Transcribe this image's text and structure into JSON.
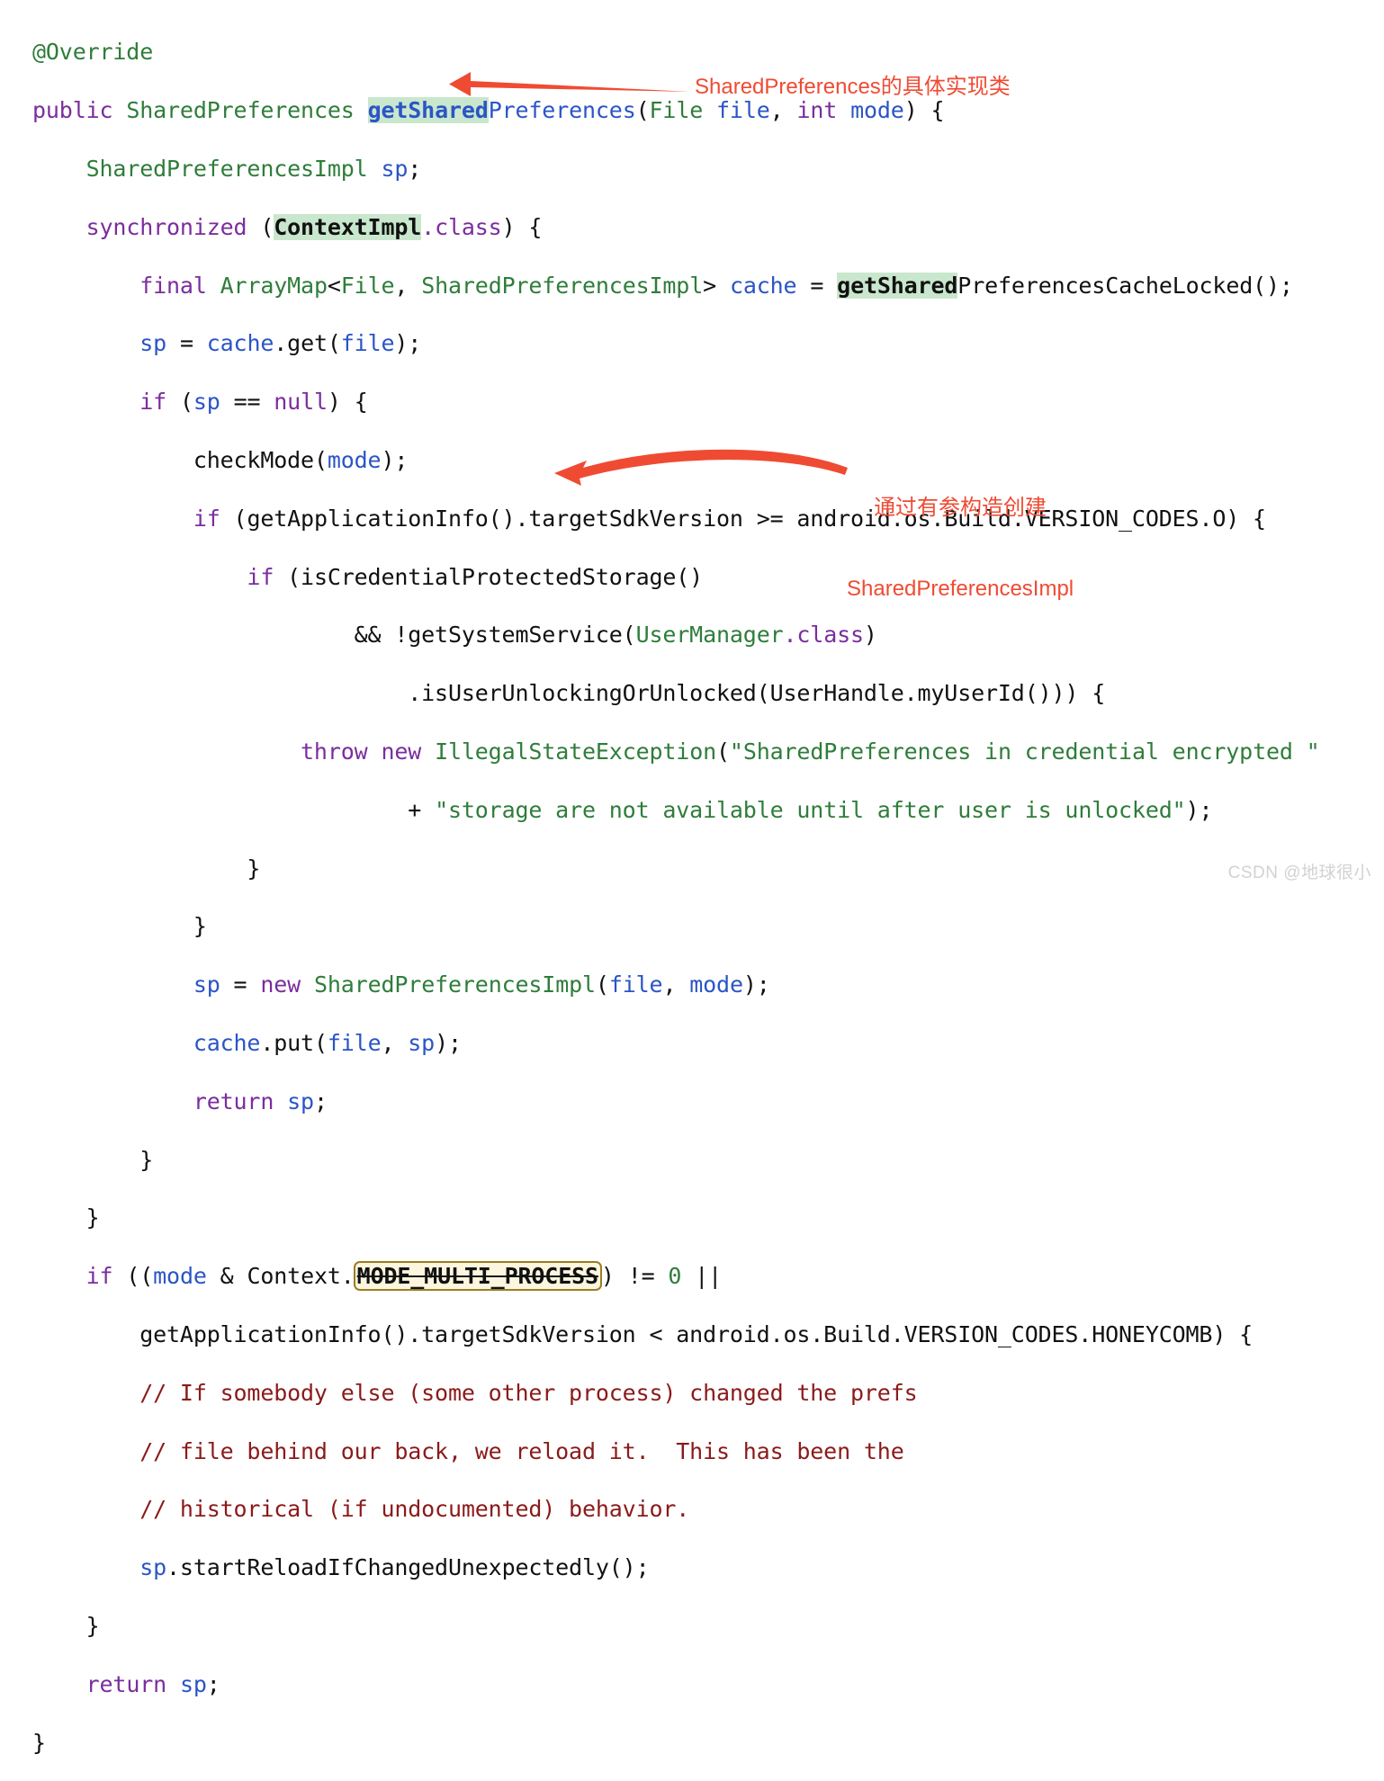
{
  "document": {
    "kind": "code-screenshot",
    "language": "Java",
    "background_color": "#ffffff",
    "theme": {
      "keyword_color": "#7b2d9e",
      "type_color": "#2f7d3a",
      "string_color": "#2f7d3a",
      "variable_color": "#2b55c6",
      "comment_color": "#8b1a1a",
      "plain_color": "#111111",
      "highlight_background": "#c9e7cd",
      "annotation_color": "#ef4b33",
      "boxed_border_color": "#9a7d24",
      "boxed_background": "#fdf6df"
    }
  },
  "code": {
    "lines": [
      "@Override",
      "public SharedPreferences getSharedPreferences(File file, int mode) {",
      "    SharedPreferencesImpl sp;",
      "    synchronized (ContextImpl.class) {",
      "        final ArrayMap<File, SharedPreferencesImpl> cache = getSharedPreferencesCacheLocked();",
      "        sp = cache.get(file);",
      "        if (sp == null) {",
      "            checkMode(mode);",
      "            if (getApplicationInfo().targetSdkVersion >= android.os.Build.VERSION_CODES.O) {",
      "                if (isCredentialProtectedStorage()",
      "                        && !getSystemService(UserManager.class)",
      "                            .isUserUnlockingOrUnlocked(UserHandle.myUserId())) {",
      "                    throw new IllegalStateException(\"SharedPreferences in credential encrypted \"",
      "                            + \"storage are not available until after user is unlocked\");",
      "                }",
      "            }",
      "            sp = new SharedPreferencesImpl(file, mode);",
      "            cache.put(file, sp);",
      "            return sp;",
      "        }",
      "    }",
      "    if ((mode & Context.MODE_MULTI_PROCESS) != 0 ||",
      "        getApplicationInfo().targetSdkVersion < android.os.Build.VERSION_CODES.HONEYCOMB) {",
      "        // If somebody else (some other process) changed the prefs",
      "        // file behind our back, we reload it.  This has been the",
      "        // historical (if undocumented) behavior.",
      "        sp.startReloadIfChangedUnexpectedly();",
      "    }",
      "    return sp;",
      "}"
    ],
    "search_highlights": [
      "getShared",
      "ContextImpl",
      "getShared"
    ],
    "boxed_strikethrough_token": "MODE_MULTI_PROCESS"
  },
  "annotations": [
    {
      "id": "anno1",
      "text": "SharedPreferences的具体实现类",
      "arrow": "straight-left",
      "points_at": "SharedPreferencesImpl sp;"
    },
    {
      "id": "anno2",
      "line1": "通过有参构造创建",
      "line2": "SharedPreferencesImpl",
      "arrow": "curved-left",
      "points_at": "sp = new SharedPreferencesImpl(file, mode);"
    }
  ],
  "watermark": {
    "text": "CSDN @地球很小"
  }
}
